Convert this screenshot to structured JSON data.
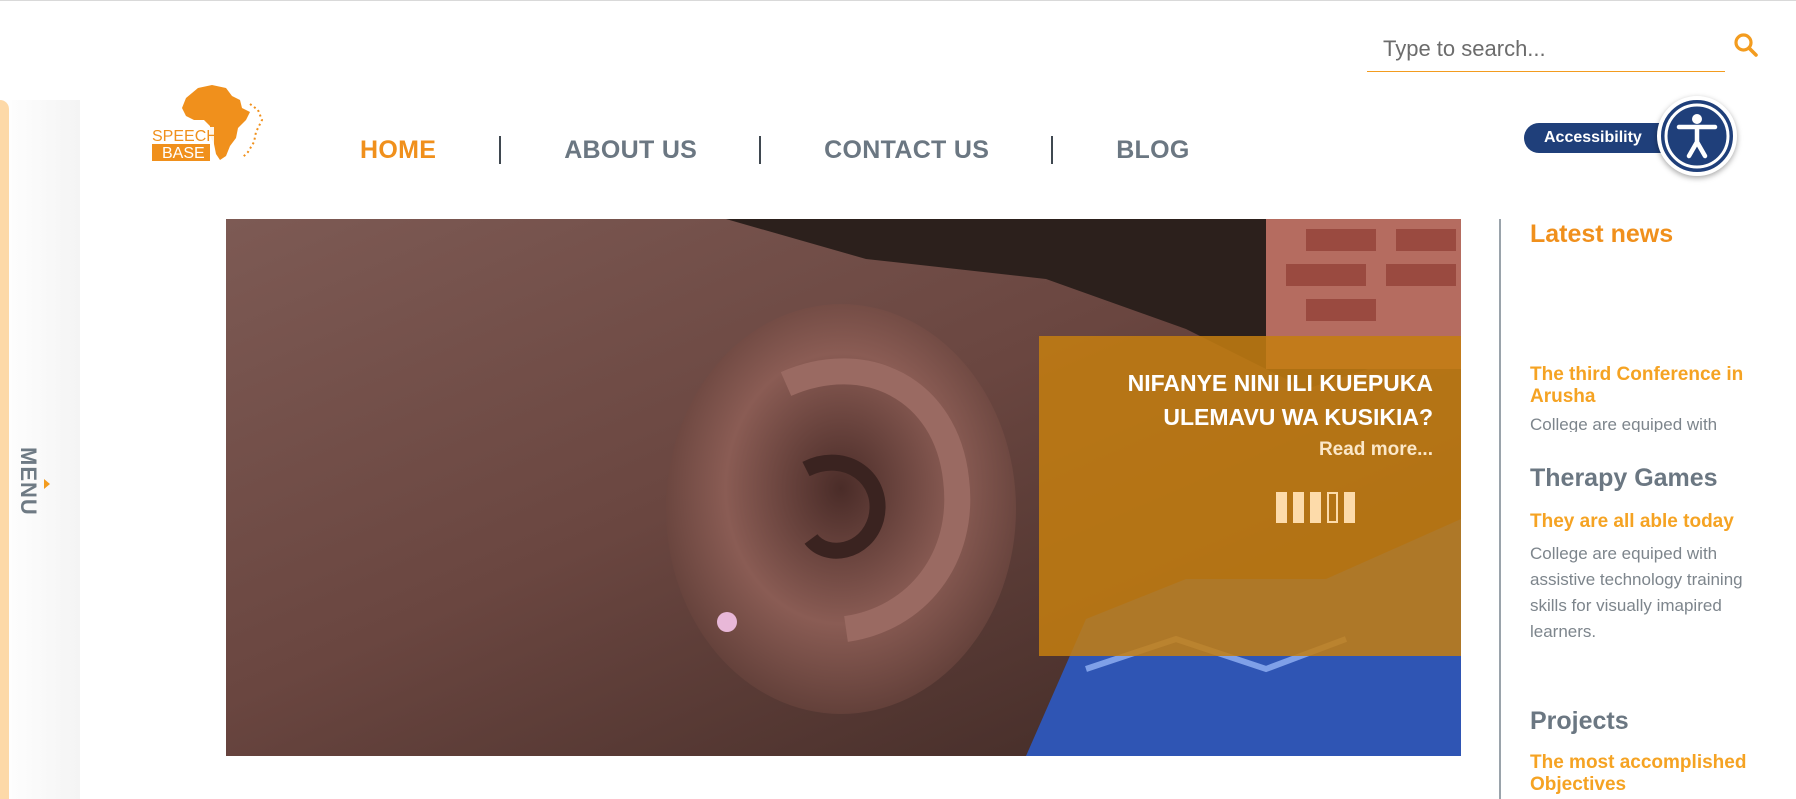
{
  "search": {
    "placeholder": "Type to search..."
  },
  "logo": {
    "line1": "SPEECH",
    "line2": "BASE"
  },
  "nav": {
    "items": [
      {
        "label": "HOME",
        "active": true
      },
      {
        "label": "ABOUT US"
      },
      {
        "label": "CONTACT US"
      },
      {
        "label": "BLOG"
      }
    ]
  },
  "accessibility": {
    "label": "Accessibility"
  },
  "side_menu": {
    "label": "MENU"
  },
  "hero": {
    "title_line1": "NIFANYE NINI ILI KUEPUKA",
    "title_line2": "ULEMAVU WA KUSIKIA?",
    "read_more": "Read more...",
    "slides_total": 5,
    "active_slide": 4
  },
  "sidebar": {
    "latest_news": {
      "heading": "Latest news",
      "item_title": "The third Conference in Arusha",
      "item_text": "College are equiped with"
    },
    "therapy_games": {
      "heading": "Therapy Games",
      "item_title": "They are all able today",
      "item_text": "College are equiped with assistive technology training skills for visually imapired learners."
    },
    "projects": {
      "heading": "Projects",
      "item_title": "The most accomplished Objectives"
    }
  },
  "colors": {
    "accent": "#f0901c",
    "nav_grey": "#6b7782",
    "caption_bg": "#c47e10",
    "a11y_blue": "#1f3f7a"
  }
}
